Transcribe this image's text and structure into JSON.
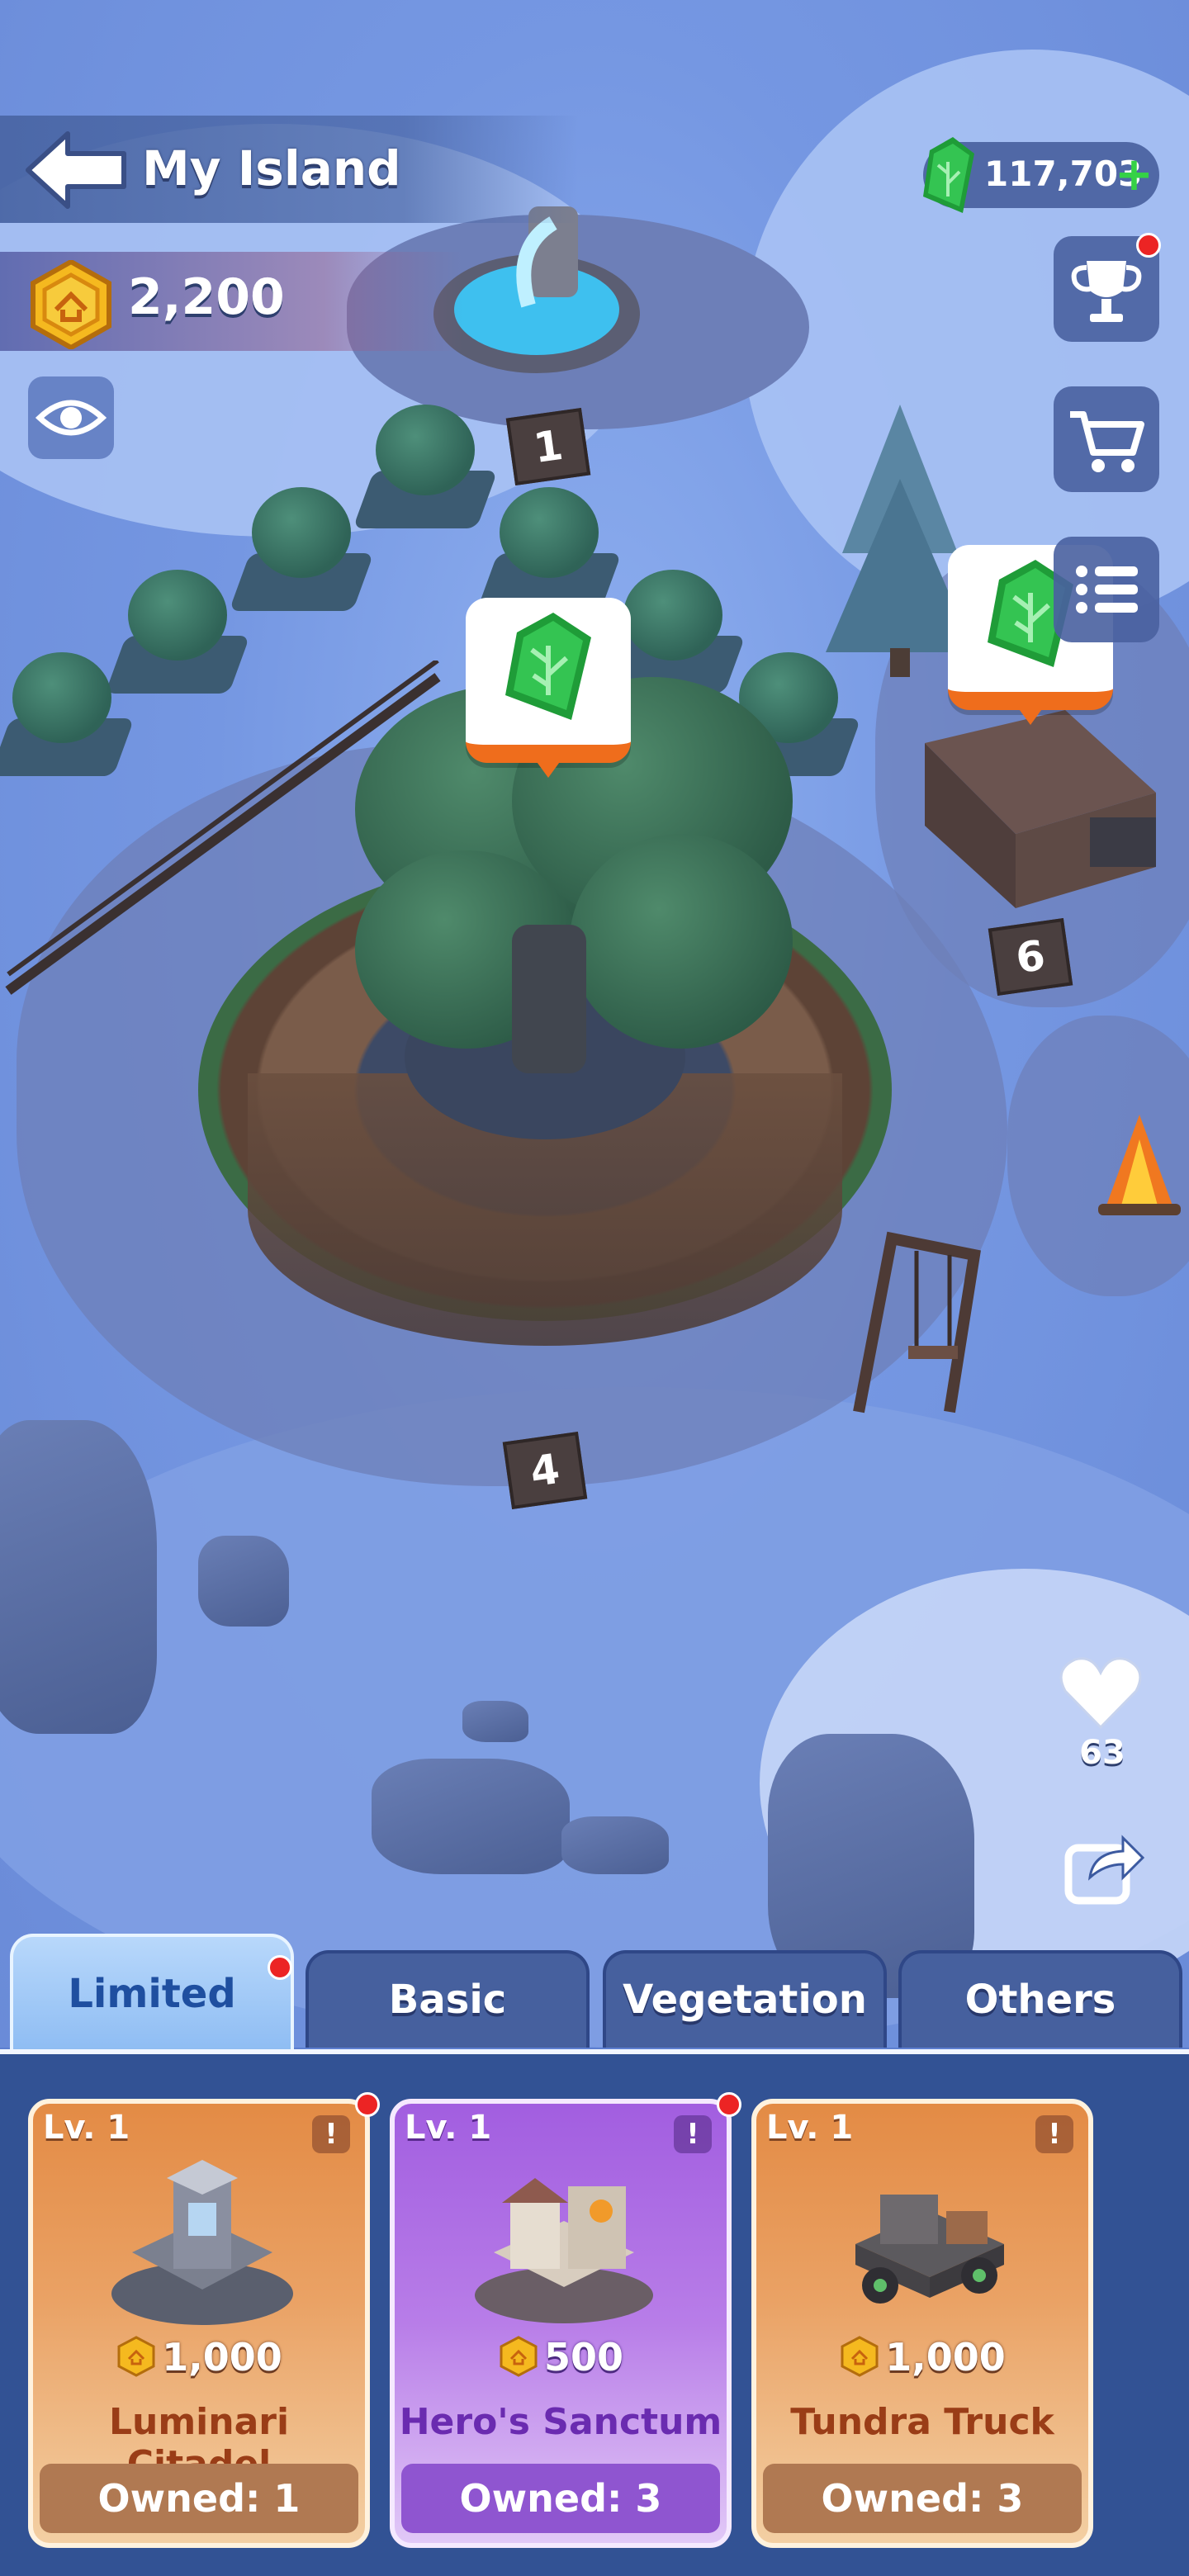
{
  "header": {
    "title": "My Island",
    "coins": "2,200",
    "gems": "117,703"
  },
  "map": {
    "plot_numbers": [
      "1",
      "6",
      "4"
    ]
  },
  "social": {
    "likes": "63"
  },
  "tabs": [
    {
      "label": "Limited",
      "active": true,
      "badge": true
    },
    {
      "label": "Basic",
      "active": false,
      "badge": false
    },
    {
      "label": "Vegetation",
      "active": false,
      "badge": false
    },
    {
      "label": "Others",
      "active": false,
      "badge": false
    }
  ],
  "cards": [
    {
      "level": "Lv. 1",
      "price": "1,000",
      "name": "Luminari Citadel",
      "owned": "Owned: 1",
      "theme": "orange",
      "badge": true
    },
    {
      "level": "Lv. 1",
      "price": "500",
      "name": "Hero's Sanctum",
      "owned": "Owned: 3",
      "theme": "purple",
      "badge": true
    },
    {
      "level": "Lv. 1",
      "price": "1,000",
      "name": "Tundra Truck",
      "owned": "Owned: 3",
      "theme": "orange",
      "badge": false
    }
  ],
  "icons": {
    "back": "back-arrow-icon",
    "coin": "hexagon-coin-icon",
    "gem": "green-leaf-gem-icon",
    "eye": "eye-icon",
    "trophy": "trophy-icon",
    "cart": "shopping-cart-icon",
    "menu": "list-menu-icon",
    "heart": "heart-icon",
    "share": "share-icon",
    "info": "exclamation-icon"
  },
  "colors": {
    "gem_green": "#2fbf4a",
    "coin_gold": "#f5b91f",
    "notification_red": "#ec2424",
    "tab_active": "#9cc6f5",
    "panel_bg": "#325294"
  }
}
